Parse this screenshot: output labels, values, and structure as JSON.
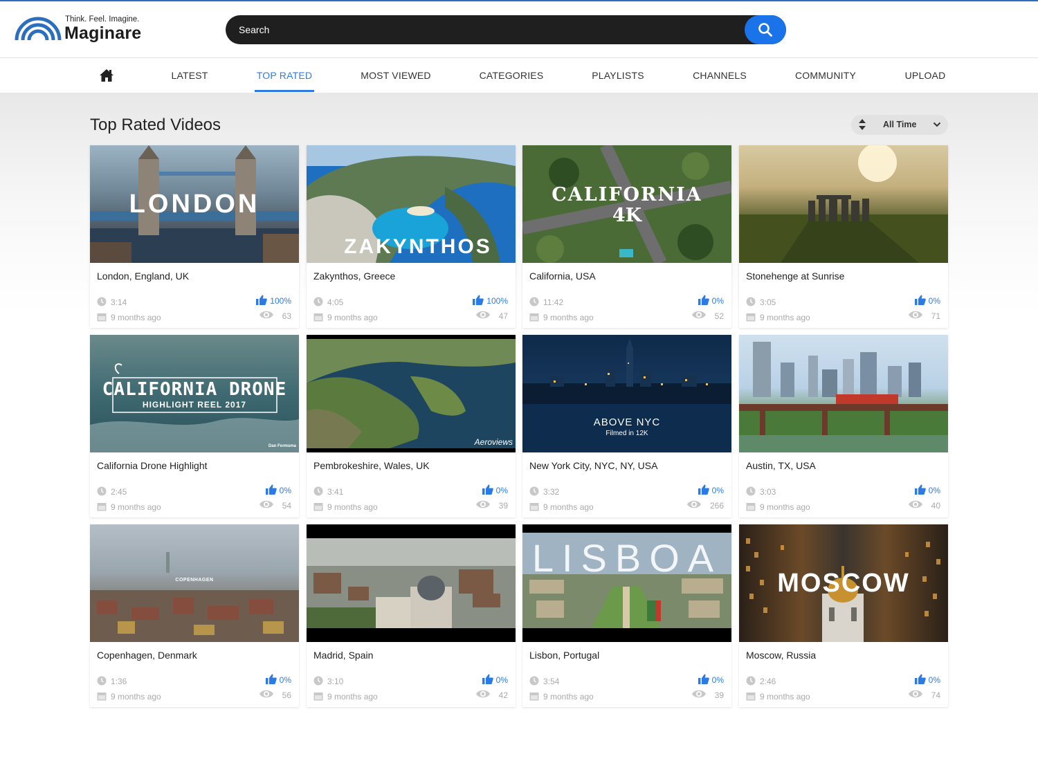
{
  "brand": {
    "tagline": "Think. Feel. Imagine.",
    "name": "Maginare",
    "accent": "#2c7be5"
  },
  "search": {
    "placeholder": "Search"
  },
  "nav": {
    "home_icon": "home-icon",
    "items": [
      "LATEST",
      "TOP RATED",
      "MOST VIEWED",
      "CATEGORIES",
      "PLAYLISTS",
      "CHANNELS",
      "COMMUNITY",
      "UPLOAD"
    ],
    "active": "TOP RATED"
  },
  "page": {
    "title": "Top Rated Videos"
  },
  "sort": {
    "label": "All Time"
  },
  "videos": [
    {
      "title": "London, England, UK",
      "duration": "3:14",
      "age": "9 months ago",
      "rating": "100%",
      "views": "63",
      "thumb_text": "LONDON"
    },
    {
      "title": "Zakynthos, Greece",
      "duration": "4:05",
      "age": "9 months ago",
      "rating": "100%",
      "views": "47",
      "thumb_text": "ZAKYNTHOS"
    },
    {
      "title": "California, USA",
      "duration": "11:42",
      "age": "9 months ago",
      "rating": "0%",
      "views": "52",
      "thumb_text": "CALIFORNIA",
      "thumb_text2": "4K"
    },
    {
      "title": "Stonehenge at Sunrise",
      "duration": "3:05",
      "age": "9 months ago",
      "rating": "0%",
      "views": "71"
    },
    {
      "title": "California Drone Highlight",
      "duration": "2:45",
      "age": "9 months ago",
      "rating": "0%",
      "views": "54",
      "thumb_text": "CALIFORNIA DRONE",
      "thumb_text2": "HIGHLIGHT REEL 2017",
      "thumb_text3": "Dan Formsma"
    },
    {
      "title": "Pembrokeshire, Wales, UK",
      "duration": "3:41",
      "age": "9 months ago",
      "rating": "0%",
      "views": "39",
      "thumb_text": "Aeroviews"
    },
    {
      "title": "New York City, NYC, NY, USA",
      "duration": "3:32",
      "age": "9 months ago",
      "rating": "0%",
      "views": "266",
      "thumb_text": "ABOVE NYC",
      "thumb_text2": "Filmed in 12K"
    },
    {
      "title": "Austin, TX, USA",
      "duration": "3:03",
      "age": "9 months ago",
      "rating": "0%",
      "views": "40"
    },
    {
      "title": "Copenhagen, Denmark",
      "duration": "1:36",
      "age": "9 months ago",
      "rating": "0%",
      "views": "56",
      "thumb_text": "COPENHAGEN"
    },
    {
      "title": "Madrid, Spain",
      "duration": "3:10",
      "age": "9 months ago",
      "rating": "0%",
      "views": "42"
    },
    {
      "title": "Lisbon, Portugal",
      "duration": "3:54",
      "age": "9 months ago",
      "rating": "0%",
      "views": "39",
      "thumb_text": "LISBOA"
    },
    {
      "title": "Moscow, Russia",
      "duration": "2:46",
      "age": "9 months ago",
      "rating": "0%",
      "views": "74",
      "thumb_text": "MOSCOW"
    }
  ]
}
